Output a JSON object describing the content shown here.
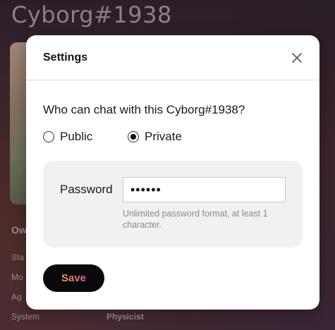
{
  "background": {
    "title": "Cyborg#1938",
    "owner_label": "Ow",
    "rows": [
      "Sta",
      "Mo",
      "Ag",
      "System"
    ],
    "system_value": "Physicist"
  },
  "modal": {
    "title": "Settings",
    "close_icon": "close-icon",
    "question": "Who can chat with this Cyborg#1938?",
    "options": [
      {
        "label": "Public",
        "selected": false
      },
      {
        "label": "Private",
        "selected": true
      }
    ],
    "password": {
      "label": "Password",
      "value": "••••••",
      "hint": "Unlimited password format, at least 1 character."
    },
    "save_label": "Save"
  },
  "colors": {
    "accent_gradient": [
      "#f7a35a",
      "#e8706e",
      "#c967c7"
    ],
    "button_bg": "#0a0a0a",
    "panel_bg": "#f1f1f1"
  }
}
